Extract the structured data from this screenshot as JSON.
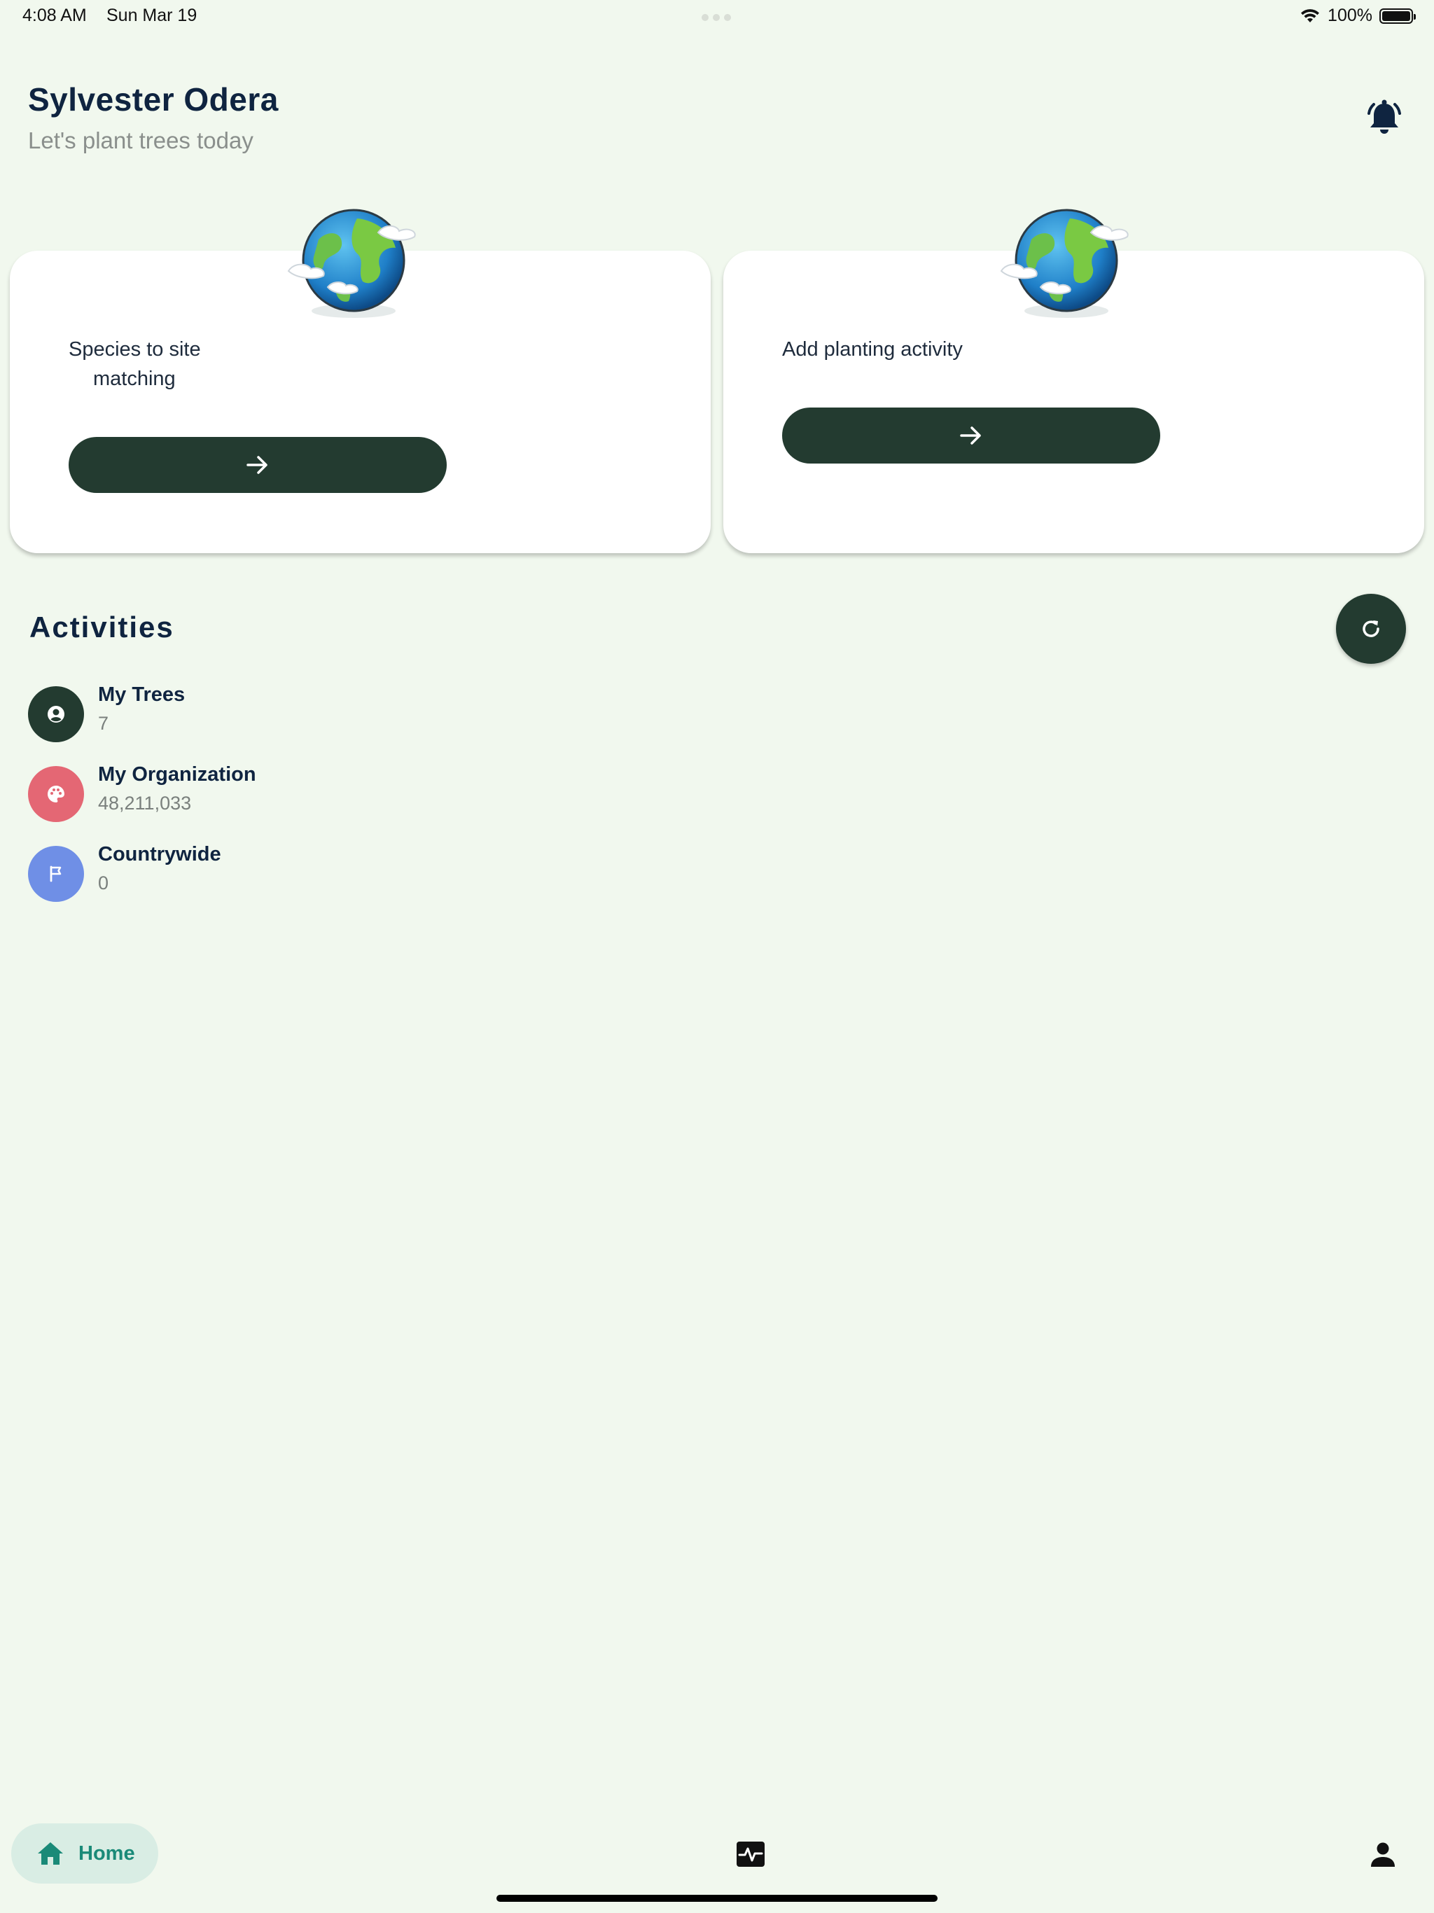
{
  "status_bar": {
    "time": "4:08 AM",
    "date": "Sun Mar 19",
    "battery": "100%"
  },
  "header": {
    "user_name": "Sylvester Odera",
    "subtitle": "Let's  plant trees today",
    "bell_icon": "bell-icon"
  },
  "cards": {
    "left": {
      "title_line1": "Species to site",
      "title_line2": "matching",
      "button_icon": "arrow-right-icon"
    },
    "right": {
      "title": "Add planting activity",
      "button_icon": "arrow-right-icon"
    }
  },
  "activities": {
    "title": "Activities",
    "refresh_icon": "refresh-icon",
    "items": [
      {
        "label": "My Trees",
        "value": "7",
        "icon": "user-circle-icon",
        "color": "#233b30"
      },
      {
        "label": "My Organization",
        "value": "48,211,033",
        "icon": "palette-icon",
        "color": "#e46774"
      },
      {
        "label": "Countrywide",
        "value": "0",
        "icon": "flag-icon",
        "color": "#6f8fe6"
      }
    ]
  },
  "nav": {
    "home_label": "Home",
    "items": [
      "home-icon",
      "activity-monitor-icon",
      "person-icon"
    ],
    "accent": "#1a8a78"
  },
  "colors": {
    "background": "#f1f8ee",
    "dark_green": "#233b30",
    "navy": "#0f2440"
  }
}
